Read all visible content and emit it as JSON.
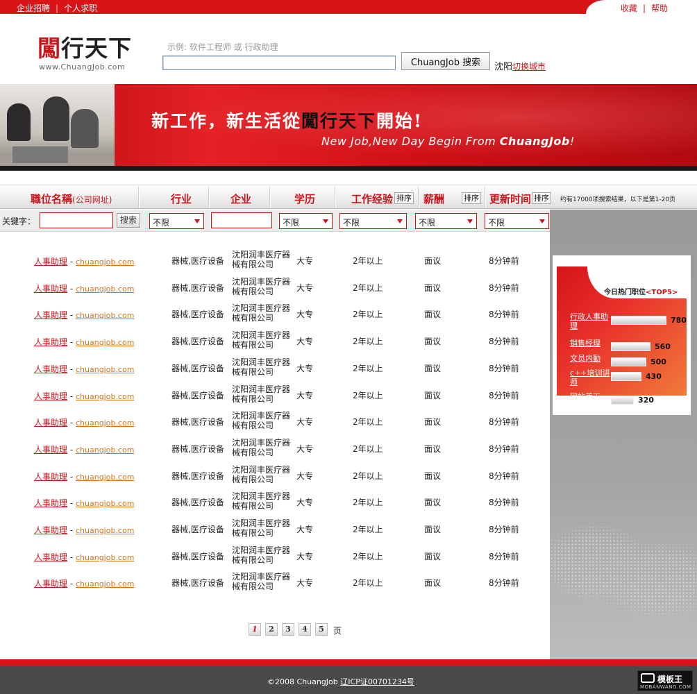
{
  "topbar": {
    "left_links": [
      "企业招聘",
      "个人求职"
    ],
    "right_links": [
      "收藏",
      "帮助"
    ],
    "separator": "|"
  },
  "logo": {
    "name_first": "闖",
    "name_rest": "行天下",
    "url": "www.ChuangJob.com"
  },
  "search": {
    "example": "示例: 软件工程师  或  行政助理",
    "value": "",
    "button_label": "ChuangJob 搜索",
    "city": "沈阳",
    "switch_city": "切换城市"
  },
  "banner": {
    "line1_a": "新工作，新生活從",
    "line1_b": "闖行天下",
    "line1_c": "開始!",
    "line2_a": "New Job,New Day Begin From ",
    "line2_b": "ChuangJob",
    "line2_c": "!"
  },
  "columns": {
    "title": "職位名稱",
    "title_sub": "(公司网址)",
    "industry": "行业",
    "company": "企业",
    "education": "学历",
    "experience": "工作经验",
    "salary": "薪酬",
    "updated": "更新时间",
    "sort_label": "排序",
    "result_count": "约有17000项搜索结果，以下是第1-20页"
  },
  "filter": {
    "keyword_label": "关键字：",
    "keyword_value": "",
    "search_label": "搜索",
    "company_value": "",
    "select_default": "不限"
  },
  "jobs": [
    {
      "title": "人事助理",
      "site": "chuangjob.com",
      "industry": "器械,医疗设备",
      "company": "沈阳润丰医疗器械有限公司",
      "education": "大专",
      "experience": "2年以上",
      "salary": "面议",
      "updated": "8分钟前"
    },
    {
      "title": "人事助理",
      "site": "chuangjob.com",
      "industry": "器械,医疗设备",
      "company": "沈阳润丰医疗器械有限公司",
      "education": "大专",
      "experience": "2年以上",
      "salary": "面议",
      "updated": "8分钟前"
    },
    {
      "title": "人事助理",
      "site": "chuangjob.com",
      "industry": "器械,医疗设备",
      "company": "沈阳润丰医疗器械有限公司",
      "education": "大专",
      "experience": "2年以上",
      "salary": "面议",
      "updated": "8分钟前"
    },
    {
      "title": "人事助理",
      "site": "chuangjob.com",
      "industry": "器械,医疗设备",
      "company": "沈阳润丰医疗器械有限公司",
      "education": "大专",
      "experience": "2年以上",
      "salary": "面议",
      "updated": "8分钟前"
    },
    {
      "title": "人事助理",
      "site": "chuangjob.com",
      "industry": "器械,医疗设备",
      "company": "沈阳润丰医疗器械有限公司",
      "education": "大专",
      "experience": "2年以上",
      "salary": "面议",
      "updated": "8分钟前"
    },
    {
      "title": "人事助理",
      "site": "chuangjob.com",
      "industry": "器械,医疗设备",
      "company": "沈阳润丰医疗器械有限公司",
      "education": "大专",
      "experience": "2年以上",
      "salary": "面议",
      "updated": "8分钟前"
    },
    {
      "title": "人事助理",
      "site": "chuangjob.com",
      "industry": "器械,医疗设备",
      "company": "沈阳润丰医疗器械有限公司",
      "education": "大专",
      "experience": "2年以上",
      "salary": "面议",
      "updated": "8分钟前"
    },
    {
      "title": "人事助理",
      "site": "chuangjob.com",
      "industry": "器械,医疗设备",
      "company": "沈阳润丰医疗器械有限公司",
      "education": "大专",
      "experience": "2年以上",
      "salary": "面议",
      "updated": "8分钟前"
    },
    {
      "title": "人事助理",
      "site": "chuangjob.com",
      "industry": "器械,医疗设备",
      "company": "沈阳润丰医疗器械有限公司",
      "education": "大专",
      "experience": "2年以上",
      "salary": "面议",
      "updated": "8分钟前"
    },
    {
      "title": "人事助理",
      "site": "chuangjob.com",
      "industry": "器械,医疗设备",
      "company": "沈阳润丰医疗器械有限公司",
      "education": "大专",
      "experience": "2年以上",
      "salary": "面议",
      "updated": "8分钟前"
    },
    {
      "title": "人事助理",
      "site": "chuangjob.com",
      "industry": "器械,医疗设备",
      "company": "沈阳润丰医疗器械有限公司",
      "education": "大专",
      "experience": "2年以上",
      "salary": "面议",
      "updated": "8分钟前"
    },
    {
      "title": "人事助理",
      "site": "chuangjob.com",
      "industry": "器械,医疗设备",
      "company": "沈阳润丰医疗器械有限公司",
      "education": "大专",
      "experience": "2年以上",
      "salary": "面议",
      "updated": "8分钟前"
    },
    {
      "title": "人事助理",
      "site": "chuangjob.com",
      "industry": "器械,医疗设备",
      "company": "沈阳润丰医疗器械有限公司",
      "education": "大专",
      "experience": "2年以上",
      "salary": "面议",
      "updated": "8分钟前"
    }
  ],
  "hot_jobs": {
    "title_a": "今日热门职位",
    "title_b": "<TOP5>",
    "items": [
      {
        "name": "行政人事助理",
        "count": 780
      },
      {
        "name": "销售经理",
        "count": 560
      },
      {
        "name": "文员内勤",
        "count": 500
      },
      {
        "name": "c++培训讲师",
        "count": 430
      },
      {
        "name": "网站美工",
        "count": 320
      }
    ]
  },
  "pager": {
    "pages": [
      "1",
      "2",
      "3",
      "4",
      "5"
    ],
    "active": "1",
    "suffix": "页"
  },
  "footer": {
    "copyright": "©2008 ChuangJob ",
    "icp": "辽ICP证00701234号"
  },
  "watermark": {
    "name": "模板王",
    "url": "MOBANWANG.COM"
  },
  "colors": {
    "brand_red": "#c8161d",
    "link_orange": "#d9731a",
    "footer_gray": "#4a4a4a"
  }
}
